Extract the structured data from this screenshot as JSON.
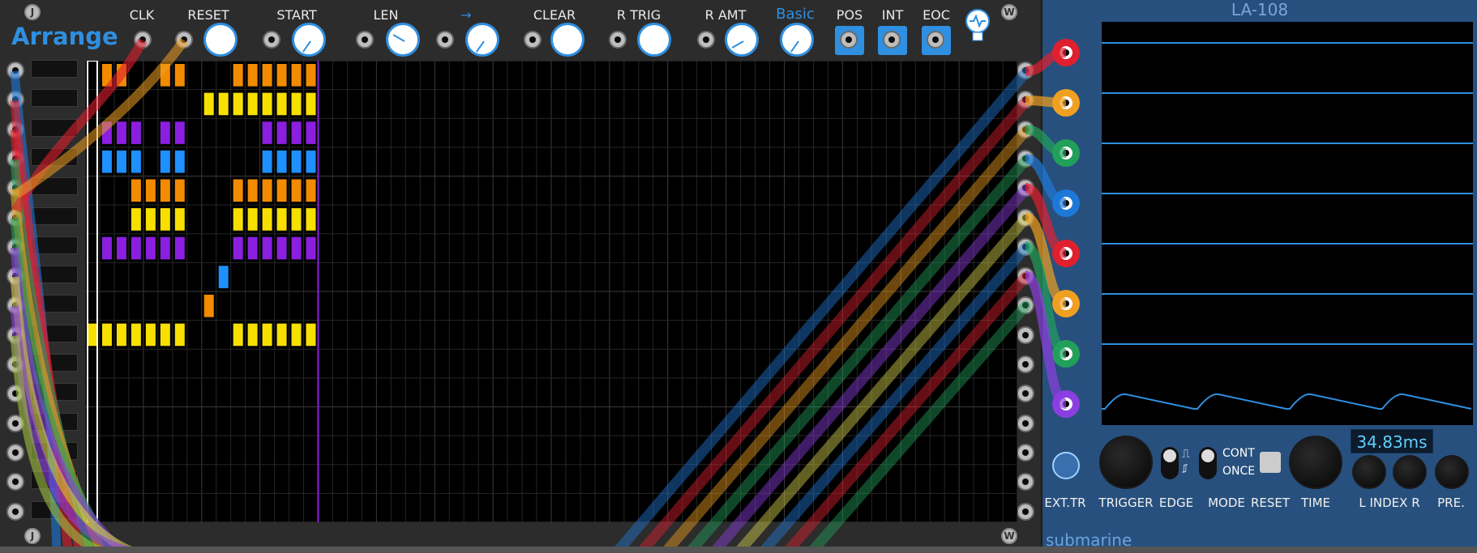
{
  "arrange": {
    "title": "Arrange",
    "labels": {
      "clk": "CLK",
      "reset": "RESET",
      "start": "START",
      "len": "LEN",
      "arrow": "→",
      "clear": "CLEAR",
      "rtrig": "R TRIG",
      "ramt": "R AMT",
      "mode": "Basic",
      "pos": "POS",
      "int": "INT",
      "eoc": "EOC"
    },
    "screws": {
      "j": "J",
      "w": "W"
    },
    "grid": {
      "rows": 16,
      "cols": 64,
      "playhead_col": 15,
      "cells": [
        {
          "row": 0,
          "color": "#f28b00",
          "cols": [
            1,
            2,
            5,
            6,
            10,
            11,
            12,
            13,
            14,
            15
          ]
        },
        {
          "row": 1,
          "color": "#f7e000",
          "cols": [
            8,
            9,
            10,
            11,
            12,
            13,
            14,
            15
          ]
        },
        {
          "row": 2,
          "color": "#8b1fe0",
          "cols": [
            1,
            2,
            3,
            5,
            6,
            12,
            13,
            14,
            15
          ]
        },
        {
          "row": 3,
          "color": "#1e90ff",
          "cols": [
            1,
            2,
            3,
            5,
            6,
            12,
            13,
            14,
            15
          ]
        },
        {
          "row": 4,
          "color": "#f28b00",
          "cols": [
            3,
            4,
            5,
            6,
            10,
            11,
            12,
            13,
            14,
            15
          ]
        },
        {
          "row": 5,
          "color": "#f7e000",
          "cols": [
            3,
            4,
            5,
            6,
            10,
            11,
            12,
            13,
            14,
            15
          ]
        },
        {
          "row": 6,
          "color": "#8b1fe0",
          "cols": [
            1,
            2,
            3,
            4,
            5,
            6,
            10,
            11,
            12,
            13,
            14,
            15
          ]
        },
        {
          "row": 7,
          "color": "#1e90ff",
          "cols": [
            9
          ]
        },
        {
          "row": 8,
          "color": "#f28b00",
          "cols": [
            8
          ]
        },
        {
          "row": 9,
          "color": "#f7e000",
          "cols": [
            0,
            1,
            2,
            3,
            4,
            5,
            6,
            10,
            11,
            12,
            13,
            14,
            15
          ]
        }
      ]
    }
  },
  "la108": {
    "title": "LA-108",
    "channel_colors": [
      "#e0202f",
      "#f0a020",
      "#21a05a",
      "#1e78d8",
      "#e0202f",
      "#f0a020",
      "#21a05a",
      "#8b3fe0"
    ],
    "controls": {
      "ext_tr": "EXT.TR",
      "trigger": "TRIGGER",
      "edge": "EDGE",
      "mode": "MODE",
      "cont": "CONT",
      "once": "ONCE",
      "reset": "RESET",
      "time": "TIME",
      "index": "L INDEX R",
      "pre": "PRE."
    },
    "time_value": "34.83ms",
    "brand": "submarine"
  },
  "colors": {
    "accent": "#2f8fe0",
    "panel": "#2c2c2c",
    "la_panel": "#28507e"
  }
}
